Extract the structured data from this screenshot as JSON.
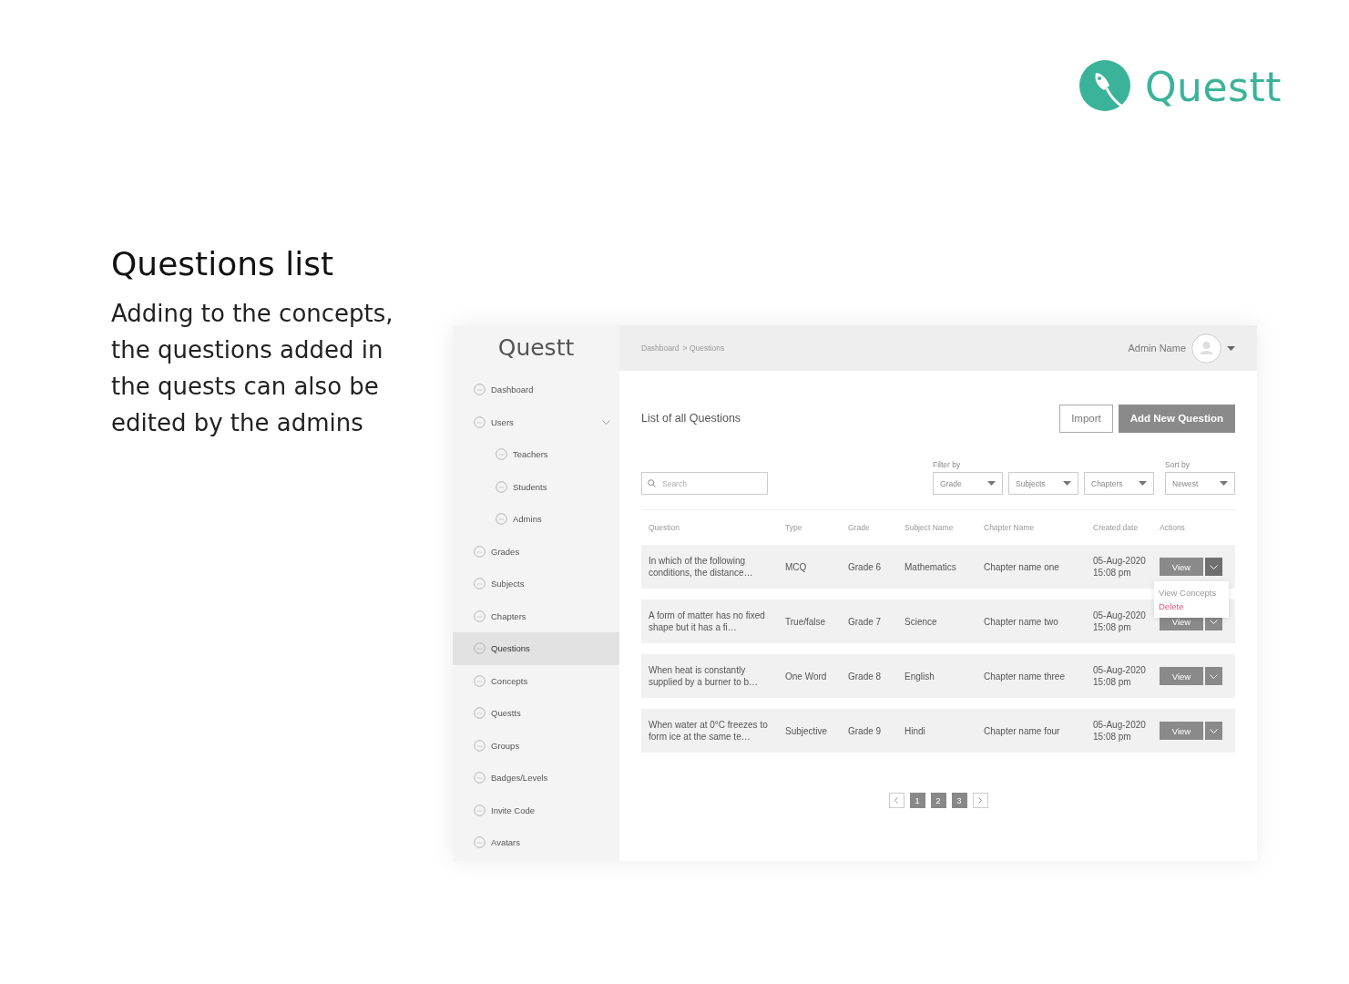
{
  "brand": {
    "name": "Questt"
  },
  "intro": {
    "title": "Questions list",
    "text": "Adding to the concepts, the questions added in the quests can also be edited by the admins"
  },
  "app": {
    "logo": "Questt",
    "sidebar": {
      "items": [
        {
          "label": "Dashboard",
          "selected": false
        },
        {
          "label": "Users",
          "selected": false,
          "expanded": true,
          "children": [
            {
              "label": "Teachers",
              "selected": false
            },
            {
              "label": "Students",
              "selected": false
            },
            {
              "label": "Admins",
              "selected": false
            }
          ]
        },
        {
          "label": "Grades",
          "selected": false
        },
        {
          "label": "Subjects",
          "selected": false
        },
        {
          "label": "Chapters",
          "selected": false
        },
        {
          "label": "Questions",
          "selected": true
        },
        {
          "label": "Concepts",
          "selected": false
        },
        {
          "label": "Questts",
          "selected": false
        },
        {
          "label": "Groups",
          "selected": false
        },
        {
          "label": "Badges/Levels",
          "selected": false
        },
        {
          "label": "Invite Code",
          "selected": false
        },
        {
          "label": "Avatars",
          "selected": false
        }
      ]
    },
    "topbar": {
      "breadcrumb": [
        "Dashboard",
        "> Questions"
      ],
      "user": "Admin Name"
    },
    "page_title": "List of all Questions",
    "buttons": [
      {
        "label": "Import",
        "kind": "outline"
      },
      {
        "label": "Add New Question",
        "kind": "primary"
      }
    ],
    "search": {
      "placeholder": "Search"
    },
    "filter_label": "Filter by",
    "filters": [
      "Grade",
      "Subjects",
      "Chapters"
    ],
    "sort_label": "Sort by",
    "sort": "Newest",
    "table": {
      "columns": [
        "Question",
        "Type",
        "Grade",
        "Subject Name",
        "Chapter Name",
        "Created date",
        "Actions"
      ],
      "rows": [
        {
          "cells": [
            "In which of the following conditions, the distance…",
            "MCQ",
            "Grade 6",
            "Mathematics",
            "Chapter name one",
            "05-Aug-2020 15:08 pm"
          ],
          "action": "View",
          "menu_open": true
        },
        {
          "cells": [
            "A form of matter has no fixed shape but it has a fi…",
            "True/false",
            "Grade 7",
            "Science",
            "Chapter name two",
            "05-Aug-2020 15:08 pm"
          ],
          "action": "View",
          "menu_open": false
        },
        {
          "cells": [
            "When heat is constantly supplied by a burner to b…",
            "One Word",
            "Grade 8",
            "English",
            "Chapter name three",
            "05-Aug-2020 15:08 pm"
          ],
          "action": "View",
          "menu_open": false
        },
        {
          "cells": [
            "When water at 0°C freezes to form ice at the same te…",
            "Subjective",
            "Grade 9",
            "Hindi",
            "Chapter name four",
            "05-Aug-2020 15:08 pm"
          ],
          "action": "View",
          "menu_open": false
        }
      ]
    },
    "row_menu": [
      {
        "label": "View Concepts",
        "kind": "normal"
      },
      {
        "label": "Delete",
        "kind": "danger"
      }
    ],
    "pagination": [
      "1",
      "2",
      "3"
    ]
  }
}
